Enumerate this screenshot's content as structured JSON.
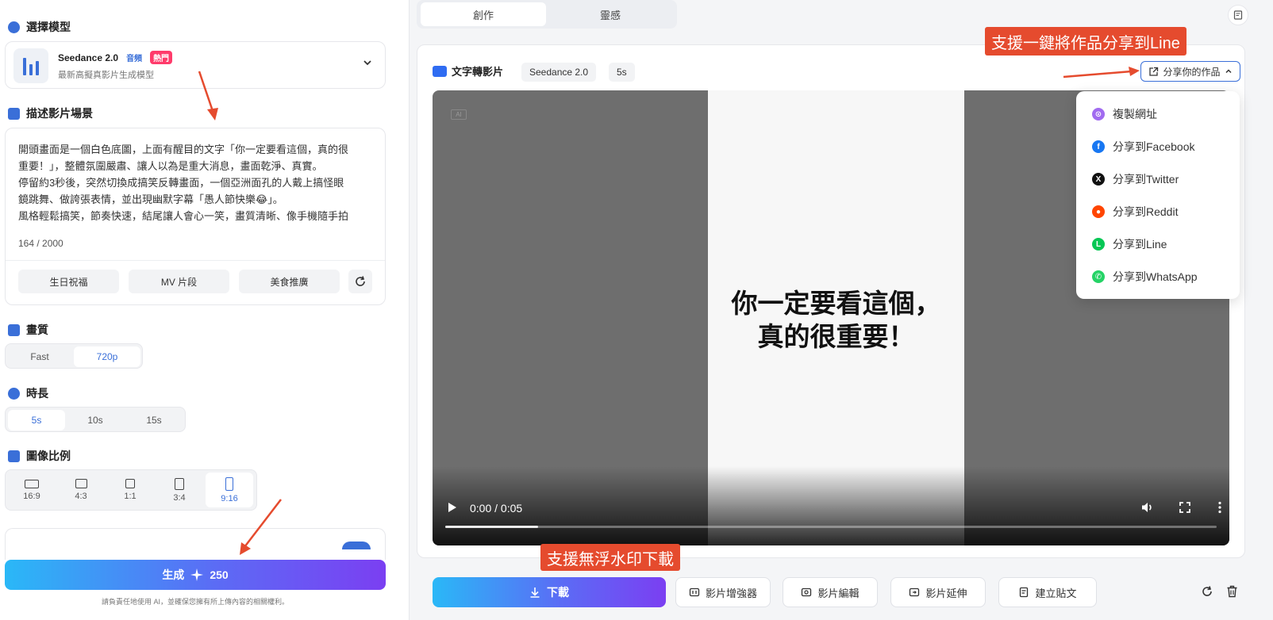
{
  "left": {
    "model_section": {
      "title": "選擇模型",
      "model_name": "Seedance 2.0",
      "audio_badge": "音頻",
      "hot_badge": "熱門",
      "model_desc": "最新高擬真影片生成模型"
    },
    "prompt_section": {
      "title": "描述影片場景",
      "lines": [
        "開頭畫面是一個白色底圖，上面有醒目的文字「你一定要看這個，真的很",
        "重要！」，整體氛圍嚴肅、讓人以為是重大消息，畫面乾淨、真實。",
        "停留約3秒後，突然切換成搞笑反轉畫面，一個亞洲面孔的人戴上搞怪眼",
        "鏡跳舞、做誇張表情，並出現幽默字幕「愚人節快樂😂」。",
        "風格輕鬆搞笑，節奏快速，結尾讓人會心一笑，畫質清晰、像手機隨手拍"
      ],
      "char_count": "164 / 2000",
      "suggestions": [
        "生日祝福",
        "MV 片段",
        "美食推廣"
      ]
    },
    "quality": {
      "title": "畫質",
      "options": [
        "Fast",
        "720p"
      ],
      "selected": "720p"
    },
    "duration": {
      "title": "時長",
      "options": [
        "5s",
        "10s",
        "15s"
      ],
      "selected": "5s"
    },
    "ratio": {
      "title": "圖像比例",
      "options": [
        "16:9",
        "4:3",
        "1:1",
        "3:4",
        "9:16"
      ],
      "selected": "9:16"
    },
    "generate": {
      "label": "生成",
      "cost": "250",
      "disclaimer": "請負責任地使用 AI，並確保您擁有所上傳內容的相關權利。"
    }
  },
  "tabs": [
    "創作",
    "靈感"
  ],
  "header": {
    "title": "文字轉影片",
    "model_pill": "Seedance 2.0",
    "duration_pill": "5s",
    "share_label": "分享你的作品"
  },
  "video": {
    "ai_badge": "AI",
    "caption_line1": "你一定要看這個，",
    "caption_line2": "真的很重要！",
    "time": "0:00 / 0:05",
    "progress": 0.12
  },
  "share_menu": [
    {
      "label": "複製網址",
      "color": "#a16bf0",
      "icon": "link-icon"
    },
    {
      "label": "分享到Facebook",
      "color": "#1877f2",
      "icon": "facebook-icon"
    },
    {
      "label": "分享到Twitter",
      "color": "#111111",
      "icon": "x-icon"
    },
    {
      "label": "分享到Reddit",
      "color": "#ff4500",
      "icon": "reddit-icon"
    },
    {
      "label": "分享到Line",
      "color": "#06c755",
      "icon": "line-icon"
    },
    {
      "label": "分享到WhatsApp",
      "color": "#25d366",
      "icon": "whatsapp-icon"
    }
  ],
  "callouts": {
    "share": "支援一鍵將作品分享到Line",
    "download": "支援無浮水印下載"
  },
  "bottom": {
    "download": "下載",
    "enhancer": "影片增強器",
    "edit": "影片編輯",
    "extend": "影片延伸",
    "post": "建立貼文"
  },
  "colors": {
    "accent": "#3a6fd8",
    "callout": "#e54b2e",
    "gradient_start": "#2ab8f7",
    "gradient_end": "#7b3ff2"
  }
}
